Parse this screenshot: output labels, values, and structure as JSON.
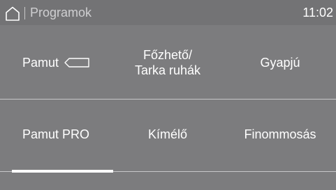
{
  "topbar": {
    "title": "Programok",
    "time": "11:02"
  },
  "programs": {
    "row1": [
      {
        "label": "Pamut",
        "icon": "cotton-tag-icon"
      },
      {
        "line1": "Főzhető/",
        "line2": "Tarka ruhák"
      },
      {
        "label": "Gyapjú"
      }
    ],
    "row2": [
      {
        "label": "Pamut PRO"
      },
      {
        "label": "Kímélő"
      },
      {
        "label": "Finommosás"
      }
    ]
  },
  "pagination": {
    "current_page": 1
  }
}
